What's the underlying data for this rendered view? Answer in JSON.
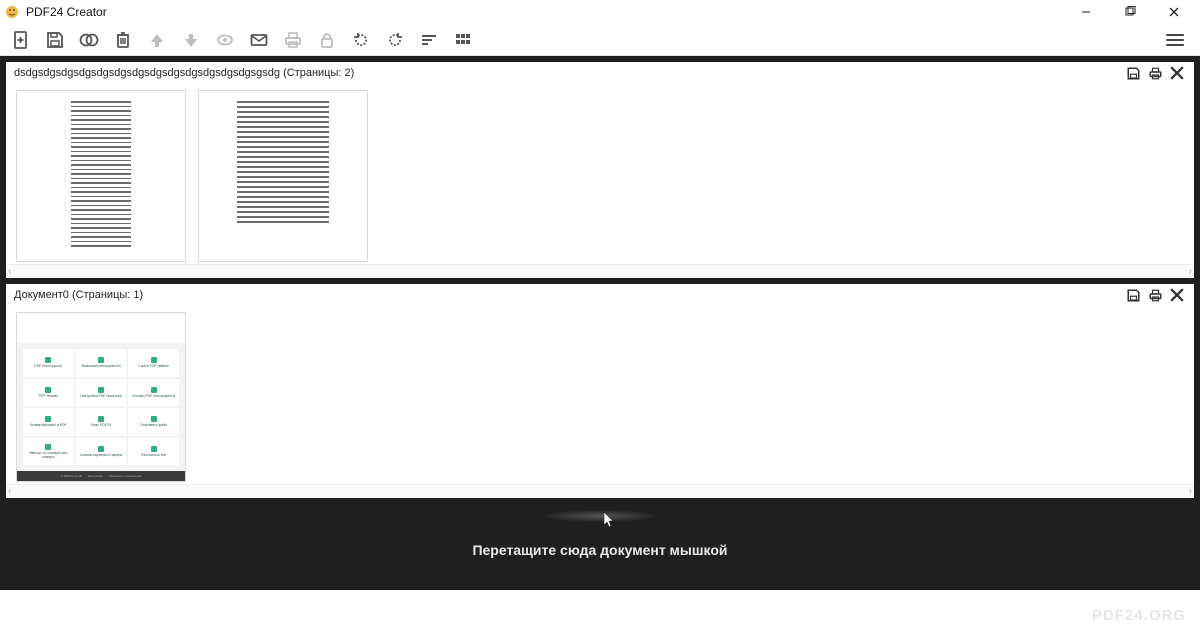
{
  "app": {
    "title": "PDF24 Creator"
  },
  "toolbar": {
    "new": "new-file",
    "save": "save",
    "merge": "merge",
    "delete": "delete",
    "up": "move-up",
    "down": "move-down",
    "preview": "preview",
    "mail": "mail",
    "print": "print",
    "lock": "lock",
    "rotate_left": "rotate-left",
    "rotate_right": "rotate-right",
    "sort": "sort",
    "grid": "grid"
  },
  "documents": [
    {
      "title": "dsdgsdgsdgsdgsdgsdgsdgsdgsdgsdgsdgsdgsdgsgsdg (Страницы: 2)",
      "pages": 2
    },
    {
      "title": "Документ0 (Страницы: 1)",
      "pages": 1
    }
  ],
  "launcher_labels": [
    "PDF Конструктор",
    "Файловые инструменты",
    "Сжать PDF файлы",
    "PDF Reader",
    "Настройка PDF принтера",
    "Онлайн PDF Инструменты",
    "Конвертировать в PDF",
    "Факс PDF24",
    "Отправить файл",
    "Импорт со сканера или камеры",
    "Снимок картинки с экрана",
    "Распознать text"
  ],
  "launcher_footer": [
    "© PDF24 Credit",
    "Настройки",
    "Проверить обновления"
  ],
  "dropzone": {
    "text": "Перетащите сюда документ мышкой"
  },
  "footer": {
    "watermark": "PDF24.ORG"
  }
}
